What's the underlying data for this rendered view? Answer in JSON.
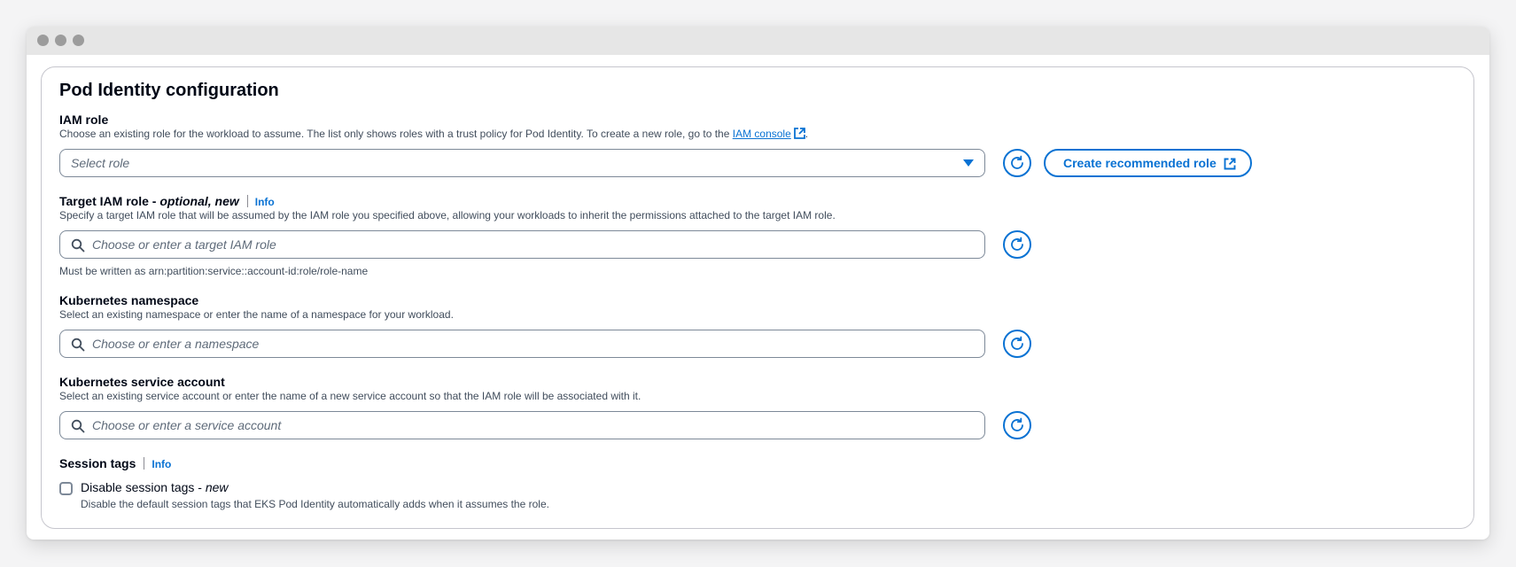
{
  "panel": {
    "title": "Pod Identity configuration"
  },
  "iam_role": {
    "label": "IAM role",
    "description": "Choose an existing role for the workload to assume. The list only shows roles with a trust policy for Pod Identity. To create a new role, go to the",
    "console_link": "IAM console",
    "description_end": ".",
    "select_placeholder": "Select role",
    "create_button": "Create recommended role"
  },
  "target_iam_role": {
    "label": "Target IAM role - ",
    "label_suffix": "optional, new",
    "info": "Info",
    "description": "Specify a target IAM role that will be assumed by the IAM role you specified above, allowing your workloads to inherit the permissions attached to the target IAM role.",
    "placeholder": "Choose or enter a target IAM role",
    "constraint": "Must be written as arn:partition:service::account-id:role/role-name"
  },
  "namespace": {
    "label": "Kubernetes namespace",
    "description": "Select an existing namespace or enter the name of a namespace for your workload.",
    "placeholder": "Choose or enter a namespace"
  },
  "service_account": {
    "label": "Kubernetes service account",
    "description": "Select an existing service account or enter the name of a new service account so that the IAM role will be associated with it.",
    "placeholder": "Choose or enter a service account"
  },
  "session_tags": {
    "label": "Session tags",
    "info": "Info",
    "checkbox_label": "Disable session tags - ",
    "checkbox_label_suffix": "new",
    "checkbox_checked": false,
    "checkbox_description": "Disable the default session tags that EKS Pod Identity automatically adds when it assumes the role."
  },
  "icons": {
    "refresh": "refresh-icon",
    "search": "search-icon",
    "external": "external-link-icon",
    "caret": "caret-down-icon"
  },
  "colors": {
    "accent": "#0972d3",
    "text": "#000716",
    "secondary_text": "#414d5c"
  }
}
